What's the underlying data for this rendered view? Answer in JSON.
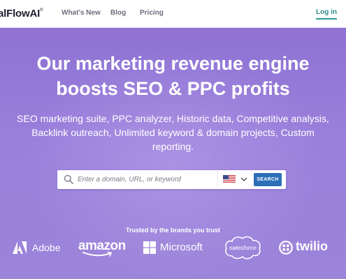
{
  "nav": {
    "logo": "alFlowAI",
    "logo_mark": "®",
    "links": [
      "What's New",
      "Blog",
      "Pricing"
    ],
    "login": "Log in"
  },
  "hero": {
    "headline_line1": "Our marketing revenue engine",
    "headline_line2": "boosts SEO & PPC profits",
    "subtext_line1": "SEO marketing suite, PPC analyzer, Historic data, Competitive analysis,",
    "subtext_line2": "Backlink outreach, Unlimited keyword & domain projects, Custom",
    "subtext_line3": "reporting."
  },
  "search": {
    "placeholder": "Enter a domain, URL, or keyword",
    "country": "us-flag",
    "button": "SEARCH"
  },
  "trusted": {
    "label": "Trusted by the brands you trust",
    "brands": [
      "Adobe",
      "amazon",
      "Microsoft",
      "salesforce",
      "twilio"
    ]
  },
  "colors": {
    "hero_top": "#8f72d4",
    "hero_bottom": "#9b84da",
    "search_button": "#2c6fb8",
    "login_accent": "#2e9a8f"
  }
}
